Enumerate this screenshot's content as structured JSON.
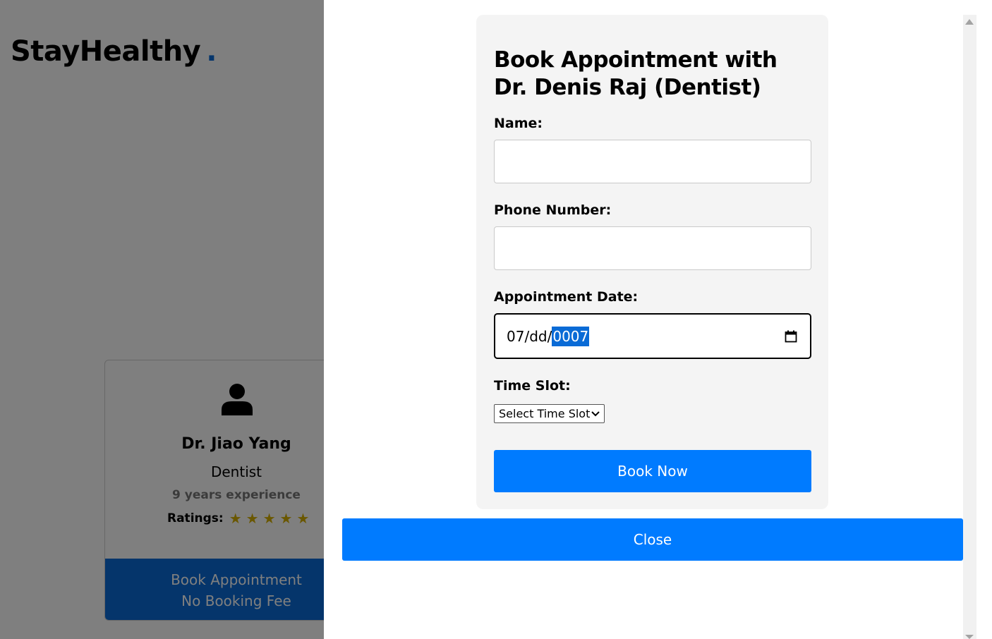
{
  "brand": {
    "name": "StayHealthy",
    "dot": "."
  },
  "doctor_card": {
    "name": "Dr. Jiao Yang",
    "specialty": "Dentist",
    "experience": "9 years experience",
    "ratings_label": "Ratings:",
    "stars": 5,
    "book_line1": "Book Appointment",
    "book_line2": "No Booking Fee"
  },
  "modal": {
    "title": "Book Appointment with Dr. Denis Raj (Dentist)",
    "name_label": "Name:",
    "name_value": "",
    "phone_label": "Phone Number:",
    "phone_value": "",
    "date_label": "Appointment Date:",
    "date_month": "07",
    "date_sep1": "/",
    "date_day": "dd",
    "date_sep2": "/",
    "date_year": "0007",
    "time_label": "Time Slot:",
    "time_select": "Select Time Slot",
    "book_now": "Book Now",
    "close": "Close"
  },
  "colors": {
    "primary": "#007bff",
    "card_button": "#0a6bd6",
    "star": "#d4af00"
  }
}
